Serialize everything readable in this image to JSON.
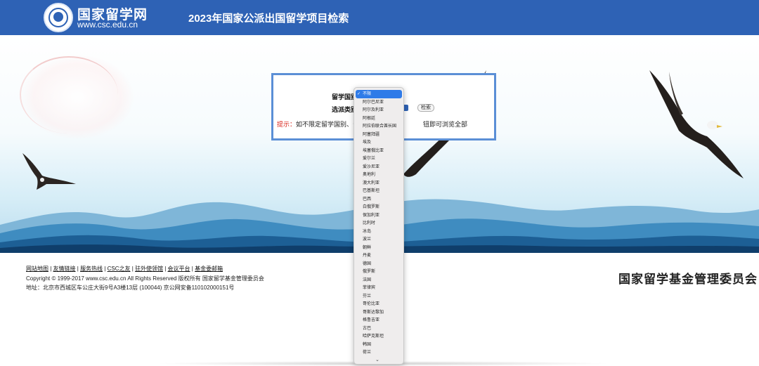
{
  "header": {
    "logo_name": "国家留学网",
    "logo_url": "www.csc.edu.cn",
    "title": "2023年国家公派出国留学项目检索"
  },
  "search": {
    "country_label": "留学国别",
    "type_label": "选派类别",
    "search_button": "检索",
    "hint_label": "提示：",
    "hint_text": "如不限定留学国别、留学",
    "hint_tail": "钮即可浏览全部"
  },
  "dropdown": {
    "selected": "不限",
    "options": [
      "不限",
      "阿尔巴尼亚",
      "阿尔及利亚",
      "阿根廷",
      "阿拉伯联合酋长国",
      "阿塞拜疆",
      "埃及",
      "埃塞俄比亚",
      "爱尔兰",
      "爱沙尼亚",
      "奥地利",
      "澳大利亚",
      "巴基斯坦",
      "巴西",
      "白俄罗斯",
      "保加利亚",
      "比利时",
      "冰岛",
      "波兰",
      "朝鲜",
      "丹麦",
      "德国",
      "俄罗斯",
      "法国",
      "菲律宾",
      "芬兰",
      "哥伦比亚",
      "哥斯达黎加",
      "格鲁吉亚",
      "古巴",
      "哈萨克斯坦",
      "韩国",
      "荷兰"
    ]
  },
  "footer": {
    "links": [
      "网站地图",
      "友情链接",
      "服务热线",
      "CSC之友",
      "驻外使领馆",
      "会议平台",
      "基金委邮箱"
    ],
    "separator": " | ",
    "copyright": "Copyright © 1999-2017 www.csc.edu.cn All Rights Reserved 版权所有 国家留学基金管理委员会",
    "address": "地址：北京市西城区车公庄大街9号A3楼13层 (100044) 京公网安备110102000151号",
    "org_mark": "国家留学基金管理委员会"
  },
  "colors": {
    "header_bg": "#2e62b5",
    "box_border": "#5b8fd6",
    "selected_option": "#2f7be8",
    "hint_label": "#d9261c"
  },
  "icons": [
    "csc-logo-icon",
    "eagle-icon",
    "checkmark-icon",
    "chevron-down-icon"
  ]
}
